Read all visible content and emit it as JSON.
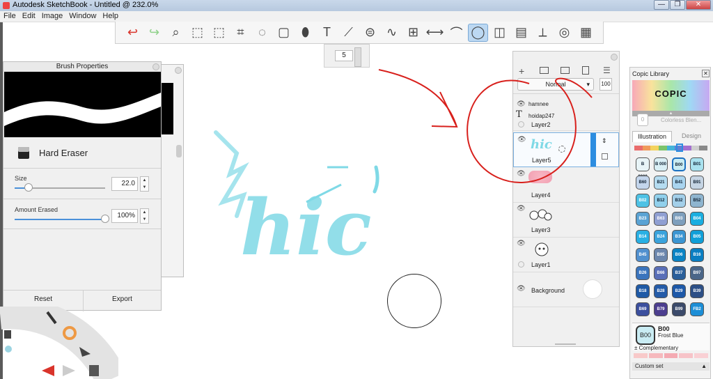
{
  "window": {
    "title": "Autodesk SketchBook - Untitled @ 232.0%",
    "minimize": "—",
    "maximize": "❐",
    "close": "✕"
  },
  "menu": [
    "File",
    "Edit",
    "Image",
    "Window",
    "Help"
  ],
  "toolbar": {
    "icons": [
      "undo-icon",
      "redo-icon",
      "zoom-icon",
      "select-icon",
      "crop-select-icon",
      "crop-icon",
      "lasso-icon",
      "transform-icon",
      "fill-bucket-icon",
      "text-icon",
      "ruler-icon",
      "ellipse-guide-icon",
      "french-curve-icon",
      "perspective-icon",
      "symmetry-icon",
      "stroke-icon",
      "brush-shape-icon",
      "shapes-icon",
      "copic-library-icon",
      "brush-palette-icon",
      "color-wheel-icon",
      "swatches-icon"
    ],
    "glyphs": [
      "↩",
      "↪",
      "⌕",
      "⬚",
      "⬚",
      "⌗",
      "◌",
      "▢",
      "⬮",
      "T",
      "⟋",
      "⊜",
      "∿",
      "⊞",
      "⟷",
      "⌒",
      "◯",
      "◫",
      "▤",
      "⟂",
      "◎",
      "▦"
    ],
    "active_index": 16,
    "undo_color": "#d9342b",
    "redo_color": "#8fd18a"
  },
  "brush_size": {
    "value": "5"
  },
  "brush_properties": {
    "title": "Brush Properties",
    "brush_name": "Hard Eraser",
    "size": {
      "label": "Size",
      "value": "22.0",
      "level": 0.15
    },
    "amount": {
      "label": "Amount Erased",
      "value": "100%",
      "level": 1.0
    },
    "reset": "Reset",
    "export": "Export"
  },
  "layers": {
    "blend_mode": "Normal",
    "opacity": "100",
    "items": [
      {
        "name": "Layer2",
        "text_lines": [
          "hamnee",
          "hoidap247"
        ]
      },
      {
        "name": "Layer5",
        "selected": true
      },
      {
        "name": "Layer4"
      },
      {
        "name": "Layer3"
      },
      {
        "name": "Layer1"
      },
      {
        "name": "Background"
      }
    ]
  },
  "copic": {
    "title": "Copic Library",
    "logo": "COPIC",
    "colorless": "Colorless Blen...",
    "tabs": [
      "Illustration",
      "Design"
    ],
    "selected_name": "B00",
    "selected_desc": "Frost Blue",
    "complementary": "Complementary",
    "custom_set": "Custom set",
    "swatches": [
      {
        "code": "B 0000",
        "color": "#e8f4f7",
        "dark": true
      },
      {
        "code": "B 000",
        "color": "#d9eff5",
        "dark": true
      },
      {
        "code": "B00",
        "color": "#c9ecf3",
        "dark": true
      },
      {
        "code": "B01",
        "color": "#a9e2ef",
        "dark": true
      },
      {
        "code": "B60",
        "color": "#c3d5ec",
        "dark": true
      },
      {
        "code": "B21",
        "color": "#b5dcf1",
        "dark": true
      },
      {
        "code": "B41",
        "color": "#a9d4ef",
        "dark": true
      },
      {
        "code": "B91",
        "color": "#c5d4e3",
        "dark": true
      },
      {
        "code": "B02",
        "color": "#4ec2e5",
        "dark": false
      },
      {
        "code": "B12",
        "color": "#91d0ec",
        "dark": true
      },
      {
        "code": "B32",
        "color": "#a3cfe9",
        "dark": true
      },
      {
        "code": "B52",
        "color": "#8fb5cf",
        "dark": true
      },
      {
        "code": "B23",
        "color": "#5aa3d4",
        "dark": false
      },
      {
        "code": "B63",
        "color": "#8f9fd2",
        "dark": false
      },
      {
        "code": "B93",
        "color": "#7e9fbd",
        "dark": false
      },
      {
        "code": "B04",
        "color": "#1aaee0",
        "dark": false
      },
      {
        "code": "B14",
        "color": "#28b0e4",
        "dark": false
      },
      {
        "code": "B24",
        "color": "#3aa3dc",
        "dark": false
      },
      {
        "code": "B34",
        "color": "#3b95d2",
        "dark": false
      },
      {
        "code": "B05",
        "color": "#109fd8",
        "dark": false
      },
      {
        "code": "B45",
        "color": "#5090cf",
        "dark": false
      },
      {
        "code": "B95",
        "color": "#6b86ad",
        "dark": false
      },
      {
        "code": "B06",
        "color": "#0a83c4",
        "dark": false
      },
      {
        "code": "B16",
        "color": "#0a7ec2",
        "dark": false
      },
      {
        "code": "B26",
        "color": "#3a74bd",
        "dark": false
      },
      {
        "code": "B66",
        "color": "#5a6fb8",
        "dark": false
      },
      {
        "code": "B37",
        "color": "#2b5f9a",
        "dark": false
      },
      {
        "code": "B97",
        "color": "#4b6688",
        "dark": false
      },
      {
        "code": "B18",
        "color": "#1f5aa6",
        "dark": false
      },
      {
        "code": "B28",
        "color": "#245ba8",
        "dark": false
      },
      {
        "code": "B29",
        "color": "#1d58a8",
        "dark": false
      },
      {
        "code": "B39",
        "color": "#2d4f86",
        "dark": false
      },
      {
        "code": "B69",
        "color": "#3b4f9e",
        "dark": false
      },
      {
        "code": "B79",
        "color": "#4c3e8f",
        "dark": false
      },
      {
        "code": "B99",
        "color": "#3b4a6a",
        "dark": false
      },
      {
        "code": "FB2",
        "color": "#1c8ed6",
        "dark": false
      }
    ],
    "palette_strip": [
      "#e96c6c",
      "#f09a5b",
      "#f4d35e",
      "#7cc46b",
      "#44b3d9",
      "#5f7fd6",
      "#a46fcf",
      "#cfcfcf",
      "#8a8a8a"
    ]
  },
  "canvas": {
    "art_text": "hic",
    "art_color": "#7fd9e6",
    "annotation_color": "#d8201c"
  },
  "lagoon": {
    "icons": [
      "layer-icon",
      "brush-icon",
      "color-wheel-icon",
      "select-arrow-icon",
      "undo-icon",
      "redo-icon",
      "copy-icon"
    ]
  }
}
